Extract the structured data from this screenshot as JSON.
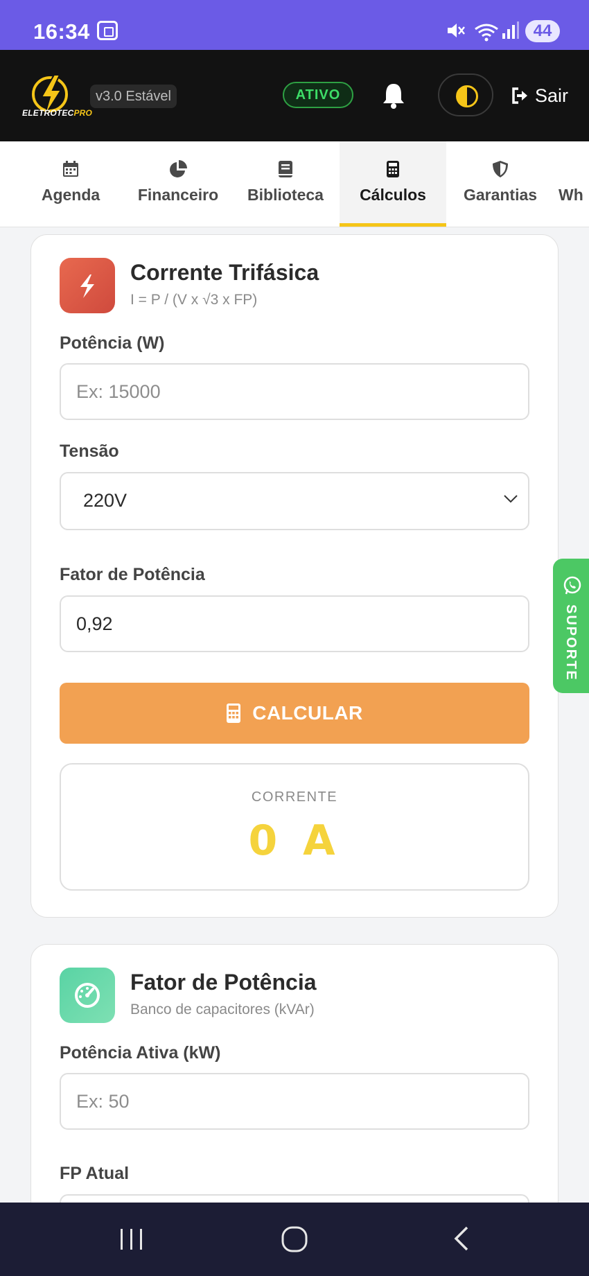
{
  "status_bar": {
    "time": "16:34",
    "battery": "44"
  },
  "header": {
    "logo_text_a": "ELETROTEC",
    "logo_text_b": "PRO",
    "version": "v3.0 Estável",
    "status_badge": "ATIVO",
    "logout_label": "Sair",
    "accent_color": "#f5c518"
  },
  "tabs": [
    {
      "label": "Agenda",
      "icon": "calendar-icon"
    },
    {
      "label": "Financeiro",
      "icon": "pie-chart-icon"
    },
    {
      "label": "Biblioteca",
      "icon": "book-icon"
    },
    {
      "label": "Cálculos",
      "icon": "calculator-icon",
      "active": true
    },
    {
      "label": "Garantias",
      "icon": "shield-icon"
    },
    {
      "label": "Wh",
      "icon": ""
    }
  ],
  "card1": {
    "title": "Corrente Trifásica",
    "subtitle": "I = P / (V x √3 x FP)",
    "field_power_label": "Potência (W)",
    "field_power_placeholder": "Ex: 15000",
    "field_voltage_label": "Tensão",
    "field_voltage_value": "220V",
    "field_pf_label": "Fator de Potência",
    "field_pf_value": "0,92",
    "calc_button": "CALCULAR",
    "result_label": "CORRENTE",
    "result_value": "0 A"
  },
  "card2": {
    "title": "Fator de Potência",
    "subtitle": "Banco de capacitores (kVAr)",
    "field_active_label": "Potência Ativa (kW)",
    "field_active_placeholder": "Ex: 50",
    "field_fp_label": "FP Atual"
  },
  "support": {
    "label": "SUPORTE"
  }
}
